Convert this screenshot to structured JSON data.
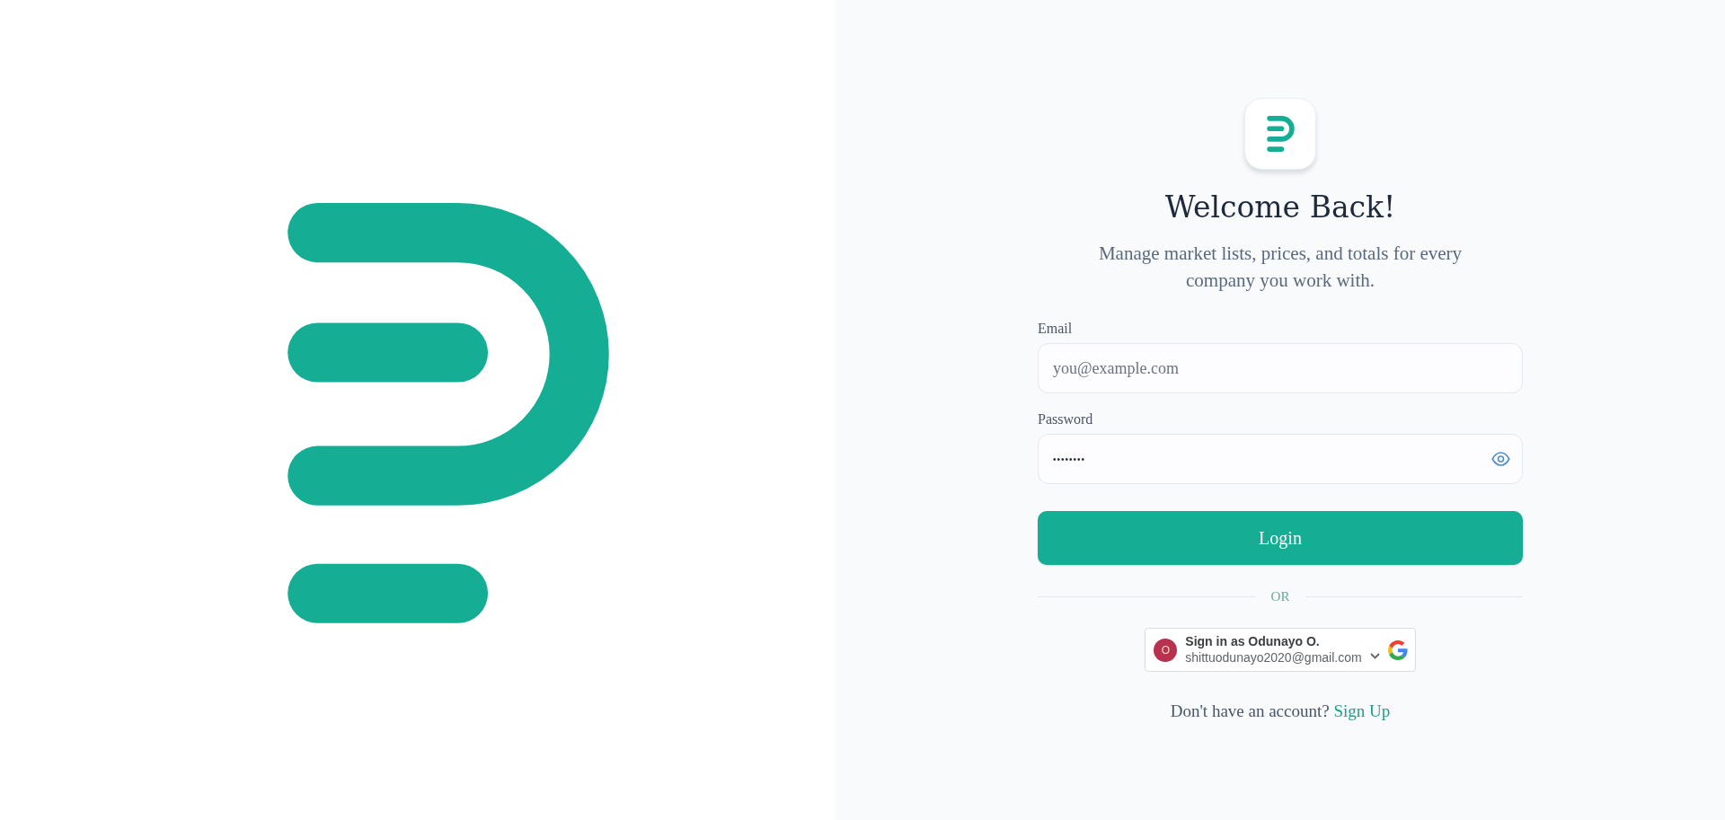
{
  "title": "Welcome Back!",
  "subtitle": "Manage market lists, prices, and totals for every company you work with.",
  "form": {
    "email": {
      "label": "Email",
      "placeholder": "you@example.com"
    },
    "password": {
      "label": "Password",
      "value": "••••••••"
    },
    "submit": "Login"
  },
  "divider": "OR",
  "google_sign_in": {
    "avatar_initial": "O",
    "title": "Sign in as Odunayo O.",
    "email": "shittuodunayo2020@gmail.com"
  },
  "signup_prompt": {
    "text": "Don't have an account?",
    "link": "Sign Up"
  }
}
